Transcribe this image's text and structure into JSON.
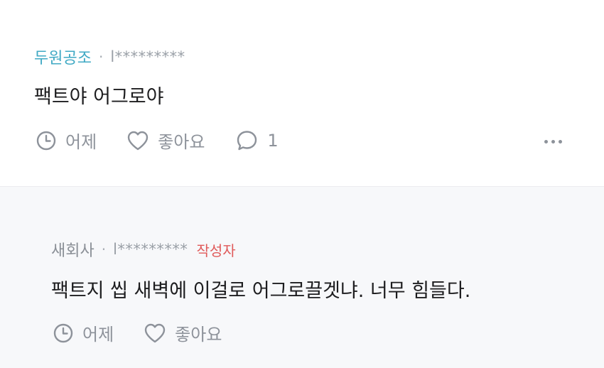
{
  "comment": {
    "author": "두원공조",
    "separator": "·",
    "user_id": "l*********",
    "text": "팩트야 어그로야",
    "time_label": "어제",
    "like_label": "좋아요",
    "reply_count": "1",
    "icons": {
      "time": "clock-icon",
      "like": "heart-icon",
      "reply": "speech-bubble-icon",
      "more": "more-dots-icon"
    }
  },
  "reply": {
    "author": "새회사",
    "separator": "·",
    "user_id": "l*********",
    "writer_badge": "작성자",
    "text": "팩트지 씹 새벽에 이걸로 어그로끌겟냐. 너무 힘들다.",
    "time_label": "어제",
    "like_label": "좋아요"
  },
  "colors": {
    "author_accent": "#3fa9c4",
    "writer_badge": "#e05a5a",
    "reply_background": "#f7f8fa",
    "icon_gray": "#8d929a"
  }
}
